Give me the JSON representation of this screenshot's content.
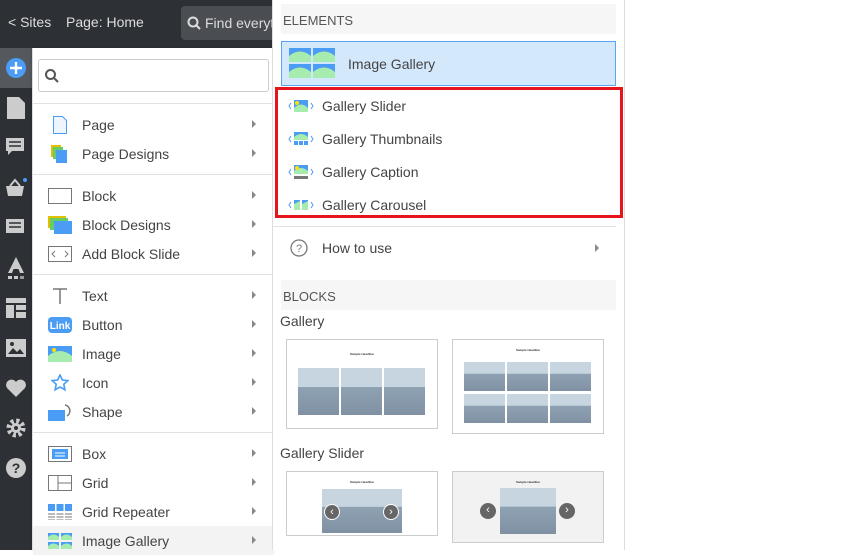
{
  "topbar": {
    "sites": "< Sites",
    "page": "Page: Home",
    "find": "Find everything"
  },
  "menu": {
    "search_placeholder": "",
    "groups": [
      [
        {
          "label": "Page",
          "icon": "page-icon"
        },
        {
          "label": "Page Designs",
          "icon": "page-designs-icon"
        }
      ],
      [
        {
          "label": "Block",
          "icon": "block-icon"
        },
        {
          "label": "Block Designs",
          "icon": "block-designs-icon"
        },
        {
          "label": "Add Block Slide",
          "icon": "add-block-slide-icon"
        }
      ],
      [
        {
          "label": "Text",
          "icon": "text-icon"
        },
        {
          "label": "Button",
          "icon": "button-icon",
          "badge": "Link"
        },
        {
          "label": "Image",
          "icon": "image-icon"
        },
        {
          "label": "Icon",
          "icon": "star-icon"
        },
        {
          "label": "Shape",
          "icon": "shape-icon"
        }
      ],
      [
        {
          "label": "Box",
          "icon": "box-icon"
        },
        {
          "label": "Grid",
          "icon": "grid-icon"
        },
        {
          "label": "Grid Repeater",
          "icon": "grid-repeater-icon"
        },
        {
          "label": "Image Gallery",
          "icon": "image-gallery-icon",
          "selected": true
        }
      ]
    ]
  },
  "panel": {
    "elements_header": "ELEMENTS",
    "selected_element": "Image Gallery",
    "elements": [
      {
        "label": "Gallery Slider"
      },
      {
        "label": "Gallery Thumbnails"
      },
      {
        "label": "Gallery Caption"
      },
      {
        "label": "Gallery Carousel"
      }
    ],
    "how_to_use": "How to use",
    "blocks_header": "BLOCKS",
    "block_groups": [
      {
        "title": "Gallery"
      },
      {
        "title": "Gallery Slider"
      }
    ],
    "sample_headline": "Sample Headline"
  },
  "colors": {
    "accent": "#4a9cf5",
    "highlight": "#e8141c",
    "dark": "#2d3035"
  }
}
